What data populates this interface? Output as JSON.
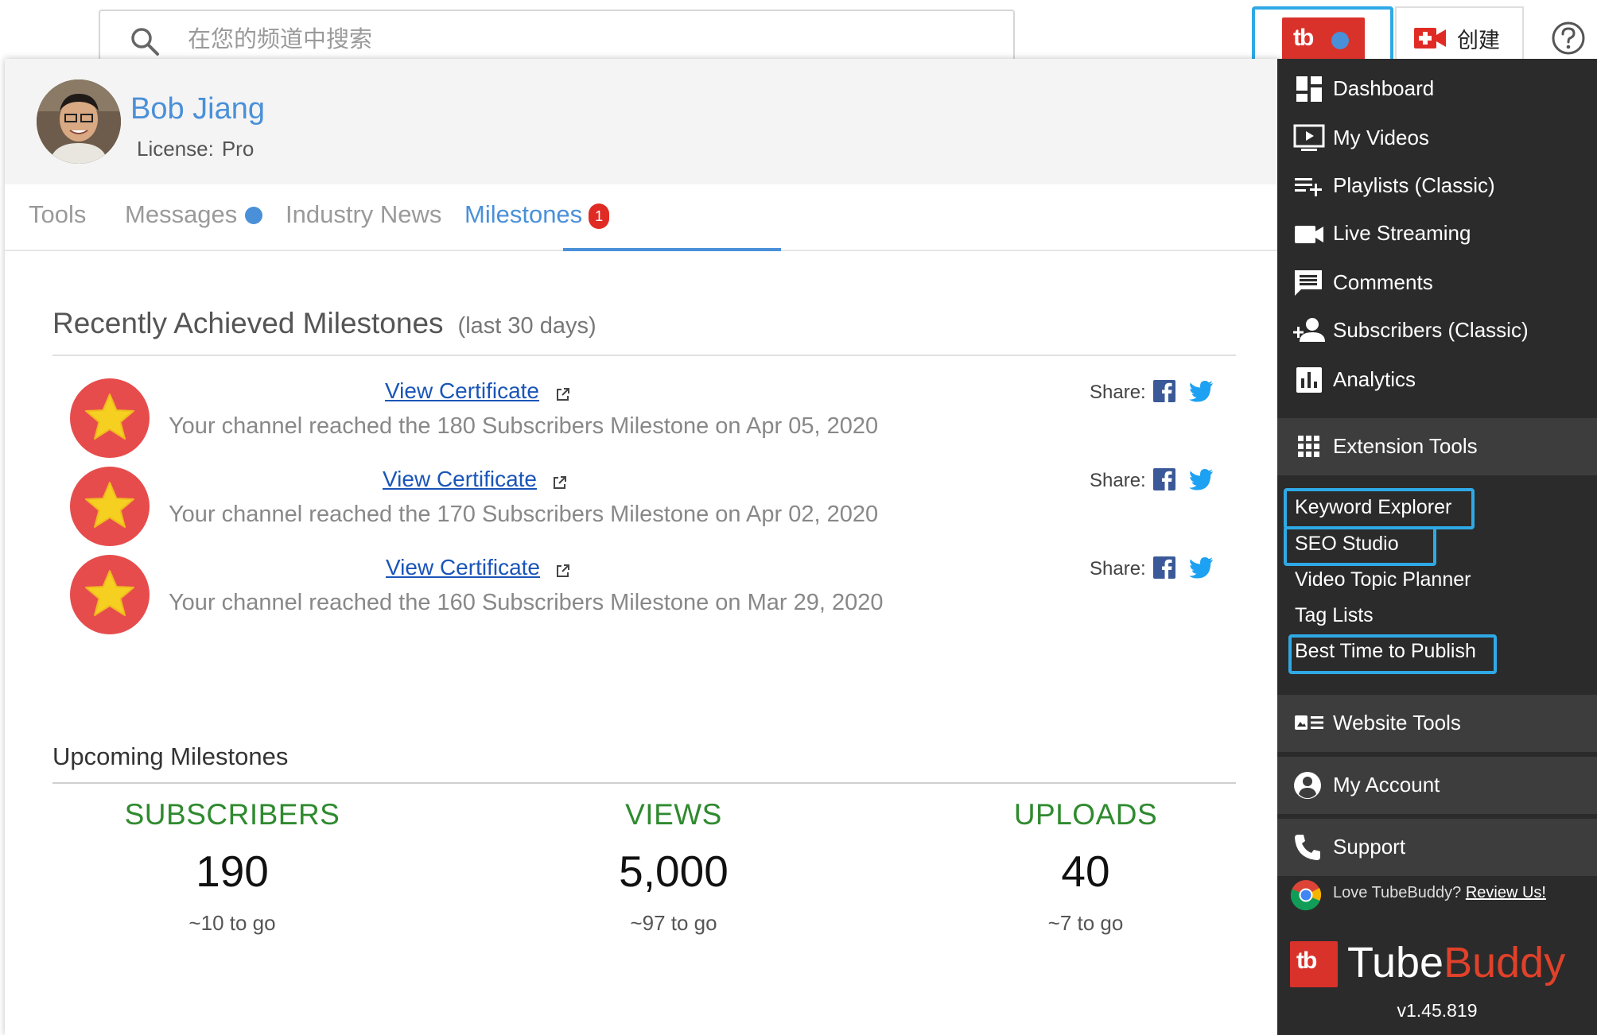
{
  "search": {
    "placeholder": "在您的频道中搜索"
  },
  "header": {
    "tb_logo": "tb",
    "create_label": "创建"
  },
  "profile": {
    "name": "Bob Jiang",
    "license_label": "License:",
    "license_value": "Pro"
  },
  "tabs": [
    {
      "label": "Tools",
      "active": false
    },
    {
      "label": "Messages",
      "active": false
    },
    {
      "label": "Industry News",
      "active": false
    },
    {
      "label": "Milestones",
      "active": true,
      "badge": "1"
    }
  ],
  "recent": {
    "title": "Recently Achieved Milestones",
    "subtitle": "(last 30 days)",
    "share_label": "Share:",
    "items": [
      {
        "link": "View Certificate",
        "text": "Your channel reached the 180 Subscribers Milestone on Apr 05, 2020"
      },
      {
        "link": "View Certificate",
        "text": "Your channel reached the 170 Subscribers Milestone on Apr 02, 2020"
      },
      {
        "link": "View Certificate",
        "text": "Your channel reached the 160 Subscribers Milestone on Mar 29, 2020"
      }
    ]
  },
  "upcoming": {
    "title": "Upcoming Milestones",
    "cols": [
      {
        "label": "SUBSCRIBERS",
        "value": "190",
        "togo": "~10 to go"
      },
      {
        "label": "VIEWS",
        "value": "5,000",
        "togo": "~97 to go"
      },
      {
        "label": "UPLOADS",
        "value": "40",
        "togo": "~7 to go"
      }
    ]
  },
  "menu": {
    "items": [
      {
        "label": "Dashboard",
        "icon": "dashboard-icon"
      },
      {
        "label": "My Videos",
        "icon": "video-icon"
      },
      {
        "label": "Playlists (Classic)",
        "icon": "playlist-add-icon"
      },
      {
        "label": "Live Streaming",
        "icon": "camera-icon"
      },
      {
        "label": "Comments",
        "icon": "comment-icon"
      },
      {
        "label": "Subscribers (Classic)",
        "icon": "person-add-icon"
      },
      {
        "label": "Analytics",
        "icon": "bar-chart-icon"
      }
    ],
    "extension_tools": "Extension Tools",
    "sub_items": [
      "Keyword Explorer",
      "SEO Studio",
      "Video Topic Planner",
      "Tag Lists",
      "Best Time to Publish"
    ],
    "website_tools": "Website Tools",
    "my_account": "My Account",
    "support": "Support",
    "review_text": "Love TubeBuddy?",
    "review_link": "Review Us!",
    "brand_tube": "Tube",
    "brand_buddy": "Buddy",
    "version": "v1.45.819"
  },
  "colors": {
    "accent": "#4a90d9",
    "brand_red": "#d9322b",
    "highlight": "#2fa9e6",
    "green": "#2f8a2f",
    "menu_bg": "#2b2b2b"
  }
}
